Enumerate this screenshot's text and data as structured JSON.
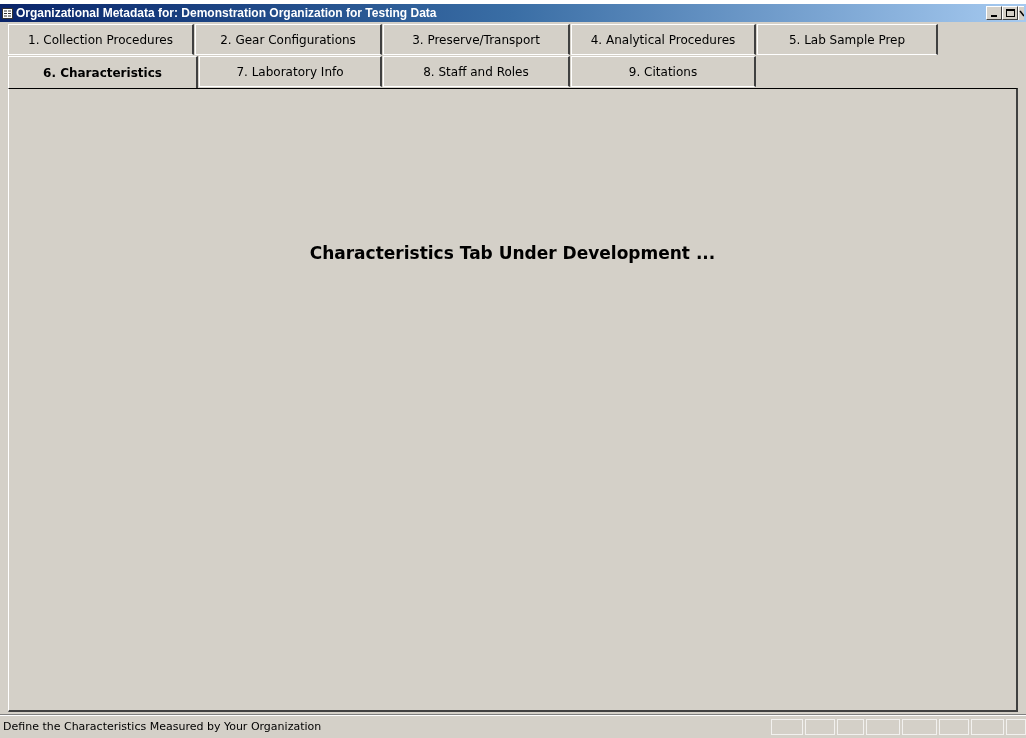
{
  "window": {
    "title": "Organizational Metadata for:  Demonstration Organization for Testing Data"
  },
  "tab_rows": [
    {
      "tabs": [
        {
          "label": "1. Collection Procedures",
          "selected": false
        },
        {
          "label": "2. Gear Configurations",
          "selected": false
        },
        {
          "label": "3. Preserve/Transport",
          "selected": false
        },
        {
          "label": "4. Analytical Procedures",
          "selected": false
        },
        {
          "label": "5. Lab Sample Prep",
          "selected": false
        }
      ]
    },
    {
      "tabs": [
        {
          "label": "6. Characteristics",
          "selected": true
        },
        {
          "label": "7. Laboratory Info",
          "selected": false
        },
        {
          "label": "8. Staff and Roles",
          "selected": false
        },
        {
          "label": "9. Citations",
          "selected": false
        }
      ]
    }
  ],
  "content": {
    "message": "Characteristics Tab Under Development ..."
  },
  "status_bar": {
    "text": "Define the Characteristics Measured by Your Organization"
  }
}
